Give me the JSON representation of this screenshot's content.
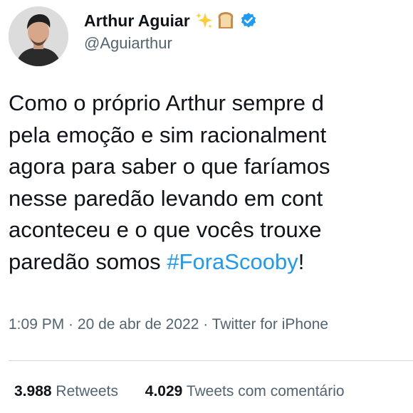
{
  "author": {
    "display_name": "Arthur Aguiar",
    "handle": "@Aguiarthur",
    "name_emoji": [
      "sparkles-icon",
      "bread-icon"
    ],
    "verified": true
  },
  "tweet": {
    "lines": [
      "Como o próprio Arthur sempre d",
      "pela emoção e sim racionalment",
      "agora para saber o que faríamos",
      "nesse paredão levando em cont",
      "aconteceu e o que vocês trouxe"
    ],
    "last_line_prefix": "paredão somos ",
    "hashtag": "#ForaScooby",
    "last_line_suffix": "!"
  },
  "meta": {
    "time": "1:09 PM",
    "sep1": " · ",
    "date": "20 de abr de 2022",
    "sep2": " · ",
    "source": "Twitter for iPhone"
  },
  "stats": {
    "retweets_count": "3.988",
    "retweets_label": "Retweets",
    "quotes_count": "4.029",
    "quotes_label": "Tweets com comentário"
  },
  "colors": {
    "text": "#0f1419",
    "secondary": "#536471",
    "link": "#1d9bf0",
    "divider": "#cfd9de"
  }
}
